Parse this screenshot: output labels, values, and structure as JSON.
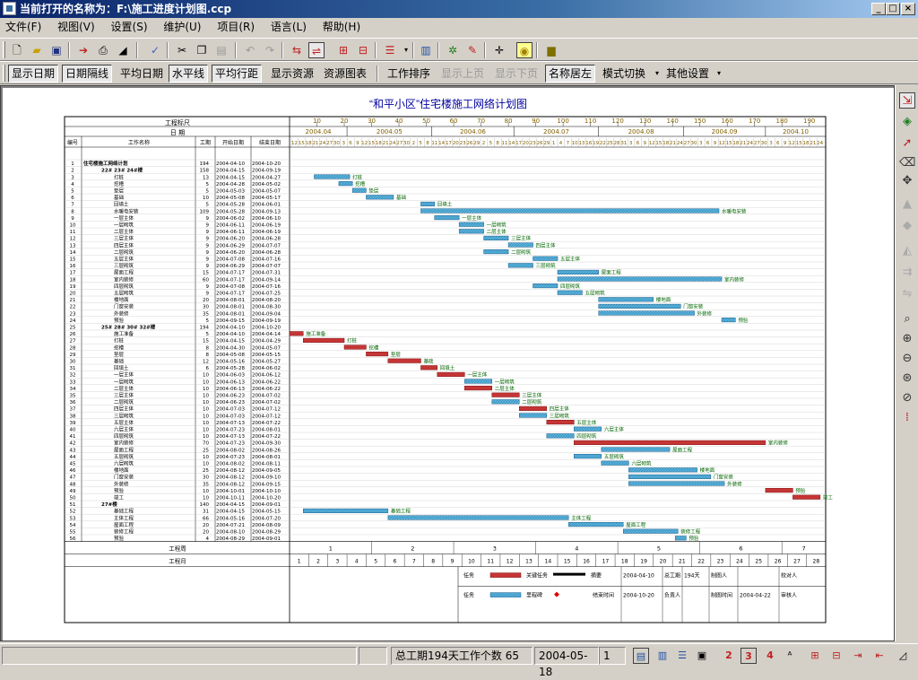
{
  "window": {
    "title": "当前打开的名称为：F:\\施工进度计划图.ccp"
  },
  "menu": [
    "文件(F)",
    "视图(V)",
    "设置(S)",
    "维护(U)",
    "项目(R)",
    "语言(L)",
    "帮助(H)"
  ],
  "toolbar2": {
    "show_date": "显示日期",
    "date_line": "日期隔线",
    "avg_date": "平均日期",
    "hline": "水平线",
    "avg_row": "平均行距",
    "show_res": "显示资源",
    "res_chart": "资源图表",
    "sort": "工作排序",
    "prev": "显示上页",
    "next": "显示下页",
    "center": "名称居左",
    "mode": "模式切换",
    "other": "其他设置"
  },
  "chart": {
    "title": "“和平小区”住宅楼施工网络计划图",
    "hdr_work_scale": "工程标尺",
    "hdr_date": "日 期",
    "col_no": "编号",
    "col_name": "工作名称",
    "col_dur": "工期",
    "col_start": "开始日期",
    "col_end": "结束日期",
    "foot_week": "工程周",
    "foot_month": "工程月"
  },
  "months": [
    "2004.04",
    "2004.05",
    "2004.06",
    "2004.07",
    "2004.08",
    "2004.09",
    "2004.10"
  ],
  "scale": [
    10,
    20,
    30,
    40,
    50,
    60,
    70,
    80,
    90,
    100,
    110,
    120,
    130,
    140,
    150,
    160,
    170,
    180,
    190
  ],
  "day_ticks": [
    "12",
    "15",
    "18",
    "21",
    "24",
    "27",
    "30",
    "3",
    "6",
    "9",
    "12",
    "15",
    "18",
    "21",
    "24",
    "27",
    "30",
    "2",
    "5",
    "8",
    "11",
    "14",
    "17",
    "20",
    "23",
    "26",
    "29",
    "2",
    "5",
    "8",
    "11",
    "14",
    "17",
    "20",
    "23",
    "26",
    "29",
    "1",
    "4",
    "7",
    "10",
    "13",
    "16",
    "19",
    "22",
    "25",
    "28",
    "31",
    "3",
    "6",
    "9",
    "12",
    "15",
    "18",
    "21",
    "24",
    "27",
    "30",
    "3",
    "6",
    "9",
    "12",
    "15",
    "18",
    "21",
    "24",
    "27",
    "30",
    "3",
    "6",
    "9",
    "12",
    "15",
    "18",
    "21",
    "24"
  ],
  "week_nums": [
    "1",
    "2",
    "3",
    "4",
    "5",
    "6",
    "7"
  ],
  "legend": {
    "task": "任务",
    "critical": "关键任务",
    "milestone": "里程碑",
    "group": "摘要",
    "planned_start": "开始时间",
    "planned_start_v": "2004-04-10",
    "total": "总工期",
    "total_v": "194天",
    "maker": "制图人",
    "reviewer": "校对人",
    "planned_end": "结束时间",
    "planned_end_v": "2004-10-20",
    "owner": "负责人",
    "date_label": "制图时间",
    "date_v": "2004-04-22",
    "auditor": "审核人"
  },
  "status": {
    "summary": "总工期194天工作个数 65",
    "date": "2004-05-18",
    "page": "1"
  },
  "chart_data": {
    "type": "gantt",
    "x_unit": "project day (1 = 2004-04-10)",
    "xlim": [
      0,
      196
    ],
    "tasks": [
      {
        "id": 1,
        "name": "住宅楼施工网络计划",
        "dur": 194,
        "start": "2004-04-10",
        "end": "2004-10-20",
        "s": 0,
        "kind": "group"
      },
      {
        "id": 2,
        "name": "22# 23# 24#楼",
        "dur": 158,
        "start": "2004-04-15",
        "end": "2004-09-19",
        "s": 0,
        "kind": "group"
      },
      {
        "id": 3,
        "name": "打桩",
        "dur": 13,
        "start": "2004-04-15",
        "end": "2004-04-27",
        "s": 9,
        "kind": "n"
      },
      {
        "id": 4,
        "name": "挖槽",
        "dur": 5,
        "start": "2004-04-28",
        "end": "2004-05-02",
        "s": 18,
        "kind": "n"
      },
      {
        "id": 5,
        "name": "垫层",
        "dur": 5,
        "start": "2004-05-03",
        "end": "2004-05-07",
        "s": 23,
        "kind": "n"
      },
      {
        "id": 6,
        "name": "基础",
        "dur": 10,
        "start": "2004-05-08",
        "end": "2004-05-17",
        "s": 28,
        "kind": "n"
      },
      {
        "id": 7,
        "name": "回填土",
        "dur": 5,
        "start": "2004-05-28",
        "end": "2004-06-01",
        "s": 48,
        "kind": "n"
      },
      {
        "id": 8,
        "name": "水暖电安装",
        "dur": 109,
        "start": "2004-05-28",
        "end": "2004-09-13",
        "s": 48,
        "kind": "n"
      },
      {
        "id": 9,
        "name": "一层主体",
        "dur": 9,
        "start": "2004-06-02",
        "end": "2004-06-10",
        "s": 53,
        "kind": "n"
      },
      {
        "id": 10,
        "name": "一层砌筑",
        "dur": 9,
        "start": "2004-06-11",
        "end": "2004-06-19",
        "s": 62,
        "kind": "n"
      },
      {
        "id": 11,
        "name": "二层主体",
        "dur": 9,
        "start": "2004-06-11",
        "end": "2004-06-19",
        "s": 62,
        "kind": "n"
      },
      {
        "id": 12,
        "name": "三层主体",
        "dur": 9,
        "start": "2004-06-20",
        "end": "2004-06-28",
        "s": 71,
        "kind": "n"
      },
      {
        "id": 13,
        "name": "四层主体",
        "dur": 9,
        "start": "2004-06-29",
        "end": "2004-07-07",
        "s": 80,
        "kind": "n"
      },
      {
        "id": 14,
        "name": "二层砌筑",
        "dur": 9,
        "start": "2004-06-20",
        "end": "2004-06-28",
        "s": 71,
        "kind": "n"
      },
      {
        "id": 15,
        "name": "五层主体",
        "dur": 9,
        "start": "2004-07-08",
        "end": "2004-07-16",
        "s": 89,
        "kind": "n"
      },
      {
        "id": 16,
        "name": "三层砌筑",
        "dur": 9,
        "start": "2004-06-29",
        "end": "2004-07-07",
        "s": 80,
        "kind": "n"
      },
      {
        "id": 17,
        "name": "屋面工程",
        "dur": 15,
        "start": "2004-07-17",
        "end": "2004-07-31",
        "s": 98,
        "kind": "n"
      },
      {
        "id": 18,
        "name": "室内装修",
        "dur": 60,
        "start": "2004-07-17",
        "end": "2004-09-14",
        "s": 98,
        "kind": "n"
      },
      {
        "id": 19,
        "name": "四层砌筑",
        "dur": 9,
        "start": "2004-07-08",
        "end": "2004-07-16",
        "s": 89,
        "kind": "n"
      },
      {
        "id": 20,
        "name": "五层砌筑",
        "dur": 9,
        "start": "2004-07-17",
        "end": "2004-07-25",
        "s": 98,
        "kind": "n"
      },
      {
        "id": 21,
        "name": "楼地面",
        "dur": 20,
        "start": "2004-08-01",
        "end": "2004-08-20",
        "s": 113,
        "kind": "n"
      },
      {
        "id": 22,
        "name": "门窗安装",
        "dur": 30,
        "start": "2004-08-01",
        "end": "2004-08-30",
        "s": 113,
        "kind": "n"
      },
      {
        "id": 23,
        "name": "外装修",
        "dur": 35,
        "start": "2004-08-01",
        "end": "2004-09-04",
        "s": 113,
        "kind": "n"
      },
      {
        "id": 24,
        "name": "预验",
        "dur": 5,
        "start": "2004-09-15",
        "end": "2004-09-19",
        "s": 158,
        "kind": "n"
      },
      {
        "id": 25,
        "name": "25# 28# 30# 32#楼",
        "dur": 194,
        "start": "2004-04-10",
        "end": "2004-10-20",
        "s": 0,
        "kind": "group"
      },
      {
        "id": 26,
        "name": "施工准备",
        "dur": 5,
        "start": "2004-04-10",
        "end": "2004-04-14",
        "s": 0,
        "kind": "c"
      },
      {
        "id": 27,
        "name": "打桩",
        "dur": 15,
        "start": "2004-04-15",
        "end": "2004-04-29",
        "s": 5,
        "kind": "c"
      },
      {
        "id": 28,
        "name": "挖槽",
        "dur": 8,
        "start": "2004-04-30",
        "end": "2004-05-07",
        "s": 20,
        "kind": "c"
      },
      {
        "id": 29,
        "name": "垫层",
        "dur": 8,
        "start": "2004-05-08",
        "end": "2004-05-15",
        "s": 28,
        "kind": "c"
      },
      {
        "id": 30,
        "name": "基础",
        "dur": 12,
        "start": "2004-05-16",
        "end": "2004-05-27",
        "s": 36,
        "kind": "c"
      },
      {
        "id": 31,
        "name": "回填土",
        "dur": 6,
        "start": "2004-05-28",
        "end": "2004-06-02",
        "s": 48,
        "kind": "c"
      },
      {
        "id": 32,
        "name": "一层主体",
        "dur": 10,
        "start": "2004-06-03",
        "end": "2004-06-12",
        "s": 54,
        "kind": "c"
      },
      {
        "id": 33,
        "name": "一层砌筑",
        "dur": 10,
        "start": "2004-06-13",
        "end": "2004-06-22",
        "s": 64,
        "kind": "n"
      },
      {
        "id": 34,
        "name": "二层主体",
        "dur": 10,
        "start": "2004-06-13",
        "end": "2004-06-22",
        "s": 64,
        "kind": "c"
      },
      {
        "id": 35,
        "name": "三层主体",
        "dur": 10,
        "start": "2004-06-23",
        "end": "2004-07-02",
        "s": 74,
        "kind": "c"
      },
      {
        "id": 36,
        "name": "二层砌筑",
        "dur": 10,
        "start": "2004-06-23",
        "end": "2004-07-02",
        "s": 74,
        "kind": "n"
      },
      {
        "id": 37,
        "name": "四层主体",
        "dur": 10,
        "start": "2004-07-03",
        "end": "2004-07-12",
        "s": 84,
        "kind": "c"
      },
      {
        "id": 38,
        "name": "三层砌筑",
        "dur": 10,
        "start": "2004-07-03",
        "end": "2004-07-12",
        "s": 84,
        "kind": "n"
      },
      {
        "id": 39,
        "name": "五层主体",
        "dur": 10,
        "start": "2004-07-13",
        "end": "2004-07-22",
        "s": 94,
        "kind": "c"
      },
      {
        "id": 40,
        "name": "六层主体",
        "dur": 10,
        "start": "2004-07-23",
        "end": "2004-08-01",
        "s": 104,
        "kind": "n"
      },
      {
        "id": 41,
        "name": "四层砌筑",
        "dur": 10,
        "start": "2004-07-13",
        "end": "2004-07-22",
        "s": 94,
        "kind": "n"
      },
      {
        "id": 42,
        "name": "室内装修",
        "dur": 70,
        "start": "2004-07-23",
        "end": "2004-09-30",
        "s": 104,
        "kind": "c"
      },
      {
        "id": 43,
        "name": "屋面工程",
        "dur": 25,
        "start": "2004-08-02",
        "end": "2004-08-26",
        "s": 114,
        "kind": "n"
      },
      {
        "id": 44,
        "name": "五层砌筑",
        "dur": 10,
        "start": "2004-07-23",
        "end": "2004-08-01",
        "s": 104,
        "kind": "n"
      },
      {
        "id": 45,
        "name": "六层砌筑",
        "dur": 10,
        "start": "2004-08-02",
        "end": "2004-08-11",
        "s": 114,
        "kind": "n"
      },
      {
        "id": 46,
        "name": "楼地面",
        "dur": 25,
        "start": "2004-08-12",
        "end": "2004-09-05",
        "s": 124,
        "kind": "n"
      },
      {
        "id": 47,
        "name": "门窗安装",
        "dur": 30,
        "start": "2004-08-12",
        "end": "2004-09-10",
        "s": 124,
        "kind": "n"
      },
      {
        "id": 48,
        "name": "外装修",
        "dur": 35,
        "start": "2004-08-12",
        "end": "2004-09-15",
        "s": 124,
        "kind": "n"
      },
      {
        "id": 49,
        "name": "预验",
        "dur": 10,
        "start": "2004-10-01",
        "end": "2004-10-10",
        "s": 174,
        "kind": "c"
      },
      {
        "id": 50,
        "name": "竣工",
        "dur": 10,
        "start": "2004-10-11",
        "end": "2004-10-20",
        "s": 184,
        "kind": "c"
      },
      {
        "id": 51,
        "name": "27#楼",
        "dur": 140,
        "start": "2004-04-15",
        "end": "2004-09-01",
        "s": 0,
        "kind": "group"
      },
      {
        "id": 52,
        "name": "基础工程",
        "dur": 31,
        "start": "2004-04-15",
        "end": "2004-05-15",
        "s": 5,
        "kind": "n"
      },
      {
        "id": 53,
        "name": "主体工程",
        "dur": 66,
        "start": "2004-05-16",
        "end": "2004-07-20",
        "s": 36,
        "kind": "n"
      },
      {
        "id": 54,
        "name": "屋面工程",
        "dur": 20,
        "start": "2004-07-21",
        "end": "2004-08-09",
        "s": 102,
        "kind": "n"
      },
      {
        "id": 55,
        "name": "装修工程",
        "dur": 20,
        "start": "2004-08-10",
        "end": "2004-08-29",
        "s": 122,
        "kind": "n"
      },
      {
        "id": 56,
        "name": "预验",
        "dur": 4,
        "start": "2004-08-29",
        "end": "2004-09-01",
        "s": 141,
        "kind": "n"
      }
    ]
  },
  "colors": {
    "normal": "#5ab4dc",
    "critical": "#d23c3c",
    "label": "#006400",
    "title": "#0000a0"
  }
}
